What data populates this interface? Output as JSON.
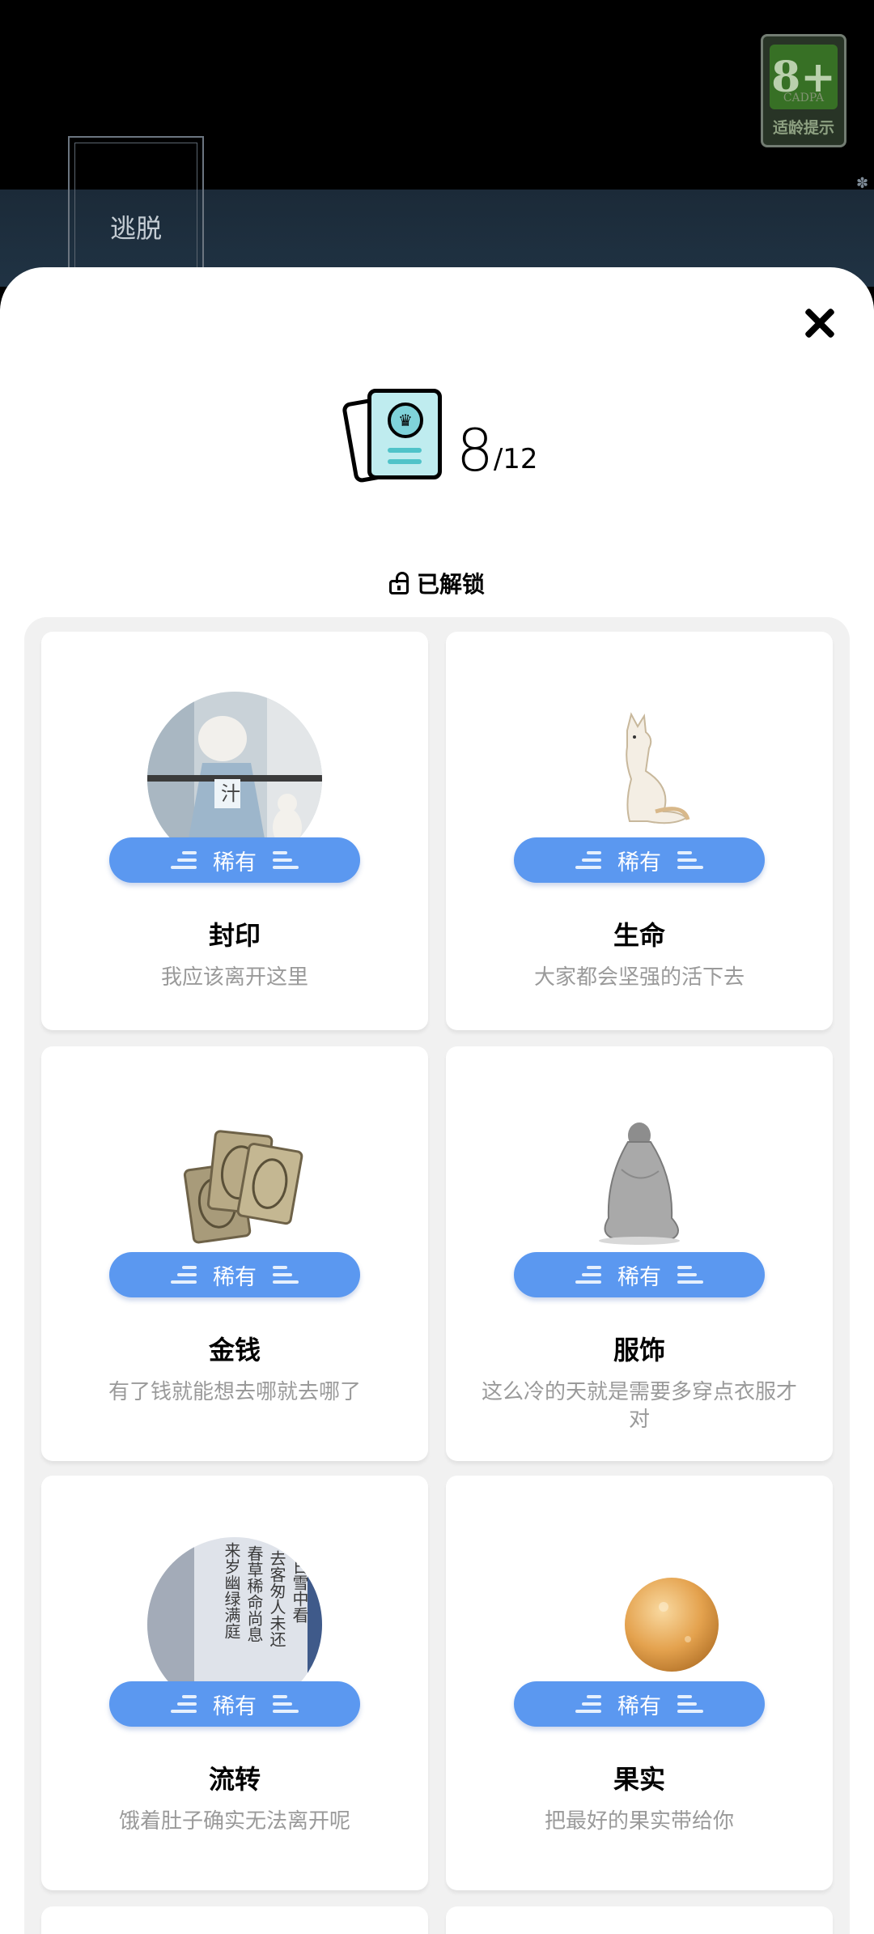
{
  "background": {
    "game_title": "逃脱",
    "age_rating": {
      "value": "8+",
      "org": "CADPA",
      "label": "适龄提示"
    }
  },
  "modal": {
    "counter": {
      "collected": "8",
      "total": "/12"
    },
    "section_label": "已解锁",
    "cards": [
      {
        "rarity": "稀有",
        "name": "封印",
        "desc": "我应该离开这里",
        "art": "boy-and-fox-portrait"
      },
      {
        "rarity": "稀有",
        "name": "生命",
        "desc": "大家都会坚强的活下去",
        "art": "white-fox"
      },
      {
        "rarity": "稀有",
        "name": "金钱",
        "desc": "有了钱就能想去哪就去哪了",
        "art": "gold-coins"
      },
      {
        "rarity": "稀有",
        "name": "服饰",
        "desc": "这么冷的天就是需要多穿点衣服才对",
        "art": "cloaked-figure"
      },
      {
        "rarity": "稀有",
        "name": "流转",
        "desc": "饿着肚子确实无法离开呢",
        "art": "poem-scroll"
      },
      {
        "rarity": "稀有",
        "name": "果实",
        "desc": "把最好的果实带给你",
        "art": "orange-fruit"
      }
    ],
    "poem_text": "春草稀稀命尚息 来岁幽绿满庭 去客匆匆人未还 长日雪中看"
  },
  "colors": {
    "rarity_pill": "#5b98f0",
    "panel": "#f1f1f1",
    "desc_text": "#9a9a9a"
  }
}
